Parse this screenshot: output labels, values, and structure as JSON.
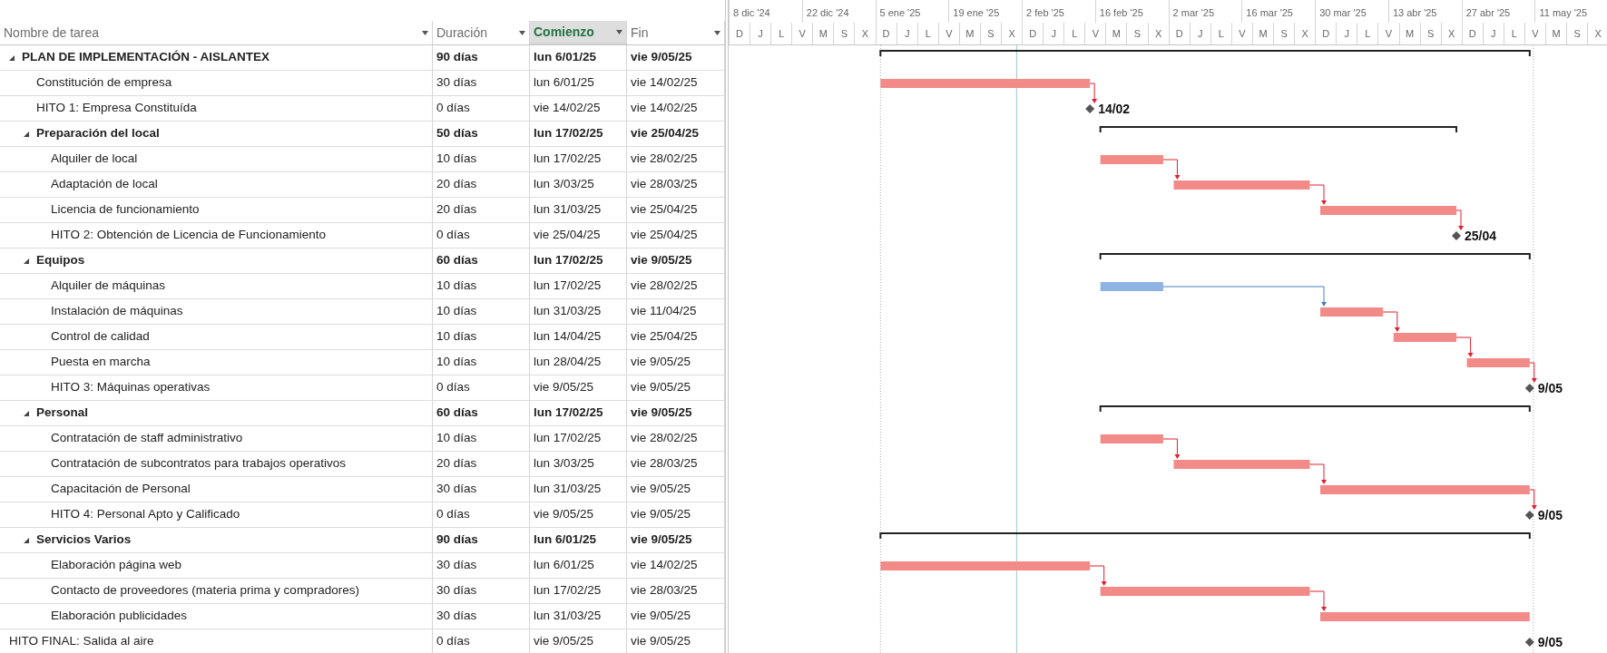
{
  "columns": [
    {
      "label": "Nombre de tarea",
      "selected": false
    },
    {
      "label": "Duración",
      "selected": false
    },
    {
      "label": "Comienzo",
      "selected": true
    },
    {
      "label": "Fin",
      "selected": false
    }
  ],
  "timescale": {
    "periods": [
      "8 dic '24",
      "22 dic '24",
      "5 ene '25",
      "19 ene '25",
      "2 feb '25",
      "16 feb '25",
      "2 mar '25",
      "16 mar '25",
      "30 mar '25",
      "13 abr '25",
      "27 abr '25",
      "11 may '25"
    ],
    "units": [
      "D",
      "J",
      "L",
      "V",
      "M",
      "S",
      "X",
      "D",
      "J",
      "L",
      "V",
      "M",
      "S",
      "X",
      "D",
      "J",
      "L",
      "V",
      "M",
      "S",
      "X",
      "D",
      "J",
      "L",
      "V",
      "M",
      "S",
      "X",
      "D",
      "J",
      "L",
      "V",
      "M",
      "S",
      "X",
      "D",
      "J",
      "L",
      "V",
      "M",
      "S",
      "X"
    ]
  },
  "tasks": [
    {
      "kind": "summary",
      "name": "PLAN DE IMPLEMENTACIÓN - AISLANTEX",
      "duration": "90 días",
      "start": "lun 6/01/25",
      "finish": "vie 9/05/25",
      "expanded": true,
      "children": [
        {
          "kind": "task",
          "name": "Constitución de empresa",
          "duration": "30 días",
          "start": "lun 6/01/25",
          "finish": "vie 14/02/25",
          "critical": true
        },
        {
          "kind": "milestone",
          "name": "HITO 1: Empresa Constituída",
          "duration": "0 días",
          "start": "vie 14/02/25",
          "finish": "vie 14/02/25",
          "bar_label": "14/02"
        },
        {
          "kind": "summary",
          "name": "Preparación del local",
          "duration": "50 días",
          "start": "lun 17/02/25",
          "finish": "vie 25/04/25",
          "expanded": true,
          "children": [
            {
              "kind": "task",
              "name": "Alquiler de local",
              "duration": "10 días",
              "start": "lun 17/02/25",
              "finish": "vie 28/02/25",
              "critical": true
            },
            {
              "kind": "task",
              "name": "Adaptación de local",
              "duration": "20 días",
              "start": "lun 3/03/25",
              "finish": "vie 28/03/25",
              "critical": true
            },
            {
              "kind": "task",
              "name": "Licencia de funcionamiento",
              "duration": "20 días",
              "start": "lun 31/03/25",
              "finish": "vie 25/04/25",
              "critical": true
            },
            {
              "kind": "milestone",
              "name": "HITO 2: Obtención de Licencia de Funcionamiento",
              "duration": "0 días",
              "start": "vie 25/04/25",
              "finish": "vie 25/04/25",
              "bar_label": "25/04"
            }
          ]
        },
        {
          "kind": "summary",
          "name": "Equipos",
          "duration": "60 días",
          "start": "lun 17/02/25",
          "finish": "vie 9/05/25",
          "expanded": true,
          "children": [
            {
              "kind": "task",
              "name": "Alquiler de máquinas",
              "duration": "10 días",
              "start": "lun 17/02/25",
              "finish": "vie 28/02/25",
              "critical": false
            },
            {
              "kind": "task",
              "name": "Instalación de máquinas",
              "duration": "10 días",
              "start": "lun 31/03/25",
              "finish": "vie 11/04/25",
              "critical": true
            },
            {
              "kind": "task",
              "name": "Control de calidad",
              "duration": "10 días",
              "start": "lun 14/04/25",
              "finish": "vie 25/04/25",
              "critical": true
            },
            {
              "kind": "task",
              "name": "Puesta en marcha",
              "duration": "10 días",
              "start": "lun 28/04/25",
              "finish": "vie 9/05/25",
              "critical": true
            },
            {
              "kind": "milestone",
              "name": "HITO 3: Máquinas operativas",
              "duration": "0 días",
              "start": "vie 9/05/25",
              "finish": "vie 9/05/25",
              "bar_label": "9/05"
            }
          ]
        },
        {
          "kind": "summary",
          "name": "Personal",
          "duration": "60 días",
          "start": "lun 17/02/25",
          "finish": "vie 9/05/25",
          "expanded": true,
          "children": [
            {
              "kind": "task",
              "name": "Contratación de staff administrativo",
              "duration": "10 días",
              "start": "lun 17/02/25",
              "finish": "vie 28/02/25",
              "critical": true
            },
            {
              "kind": "task",
              "name": "Contratación de subcontratos para trabajos operativos",
              "duration": "20 días",
              "start": "lun 3/03/25",
              "finish": "vie 28/03/25",
              "critical": true
            },
            {
              "kind": "task",
              "name": "Capacitación de Personal",
              "duration": "30 días",
              "start": "lun 31/03/25",
              "finish": "vie 9/05/25",
              "critical": true
            },
            {
              "kind": "milestone",
              "name": "HITO 4: Personal Apto y Calificado",
              "duration": "0 días",
              "start": "vie 9/05/25",
              "finish": "vie 9/05/25",
              "bar_label": "9/05"
            }
          ]
        },
        {
          "kind": "summary",
          "name": "Servicios Varios",
          "duration": "90 días",
          "start": "lun 6/01/25",
          "finish": "vie 9/05/25",
          "expanded": true,
          "children": [
            {
              "kind": "task",
              "name": "Elaboración página web",
              "duration": "30 días",
              "start": "lun 6/01/25",
              "finish": "vie 14/02/25",
              "critical": true
            },
            {
              "kind": "task",
              "name": "Contacto de proveedores (materia prima y compradores)",
              "duration": "30 días",
              "start": "lun 17/02/25",
              "finish": "vie 28/03/25",
              "critical": true
            },
            {
              "kind": "task",
              "name": "Elaboración publicidades",
              "duration": "30 días",
              "start": "lun 31/03/25",
              "finish": "vie 9/05/25",
              "critical": true
            }
          ]
        }
      ]
    },
    {
      "kind": "milestone",
      "name": "HITO FINAL: Salida al aire",
      "duration": "0 días",
      "start": "vie 9/05/25",
      "finish": "vie 9/05/25",
      "bar_label": "9/05"
    }
  ]
}
